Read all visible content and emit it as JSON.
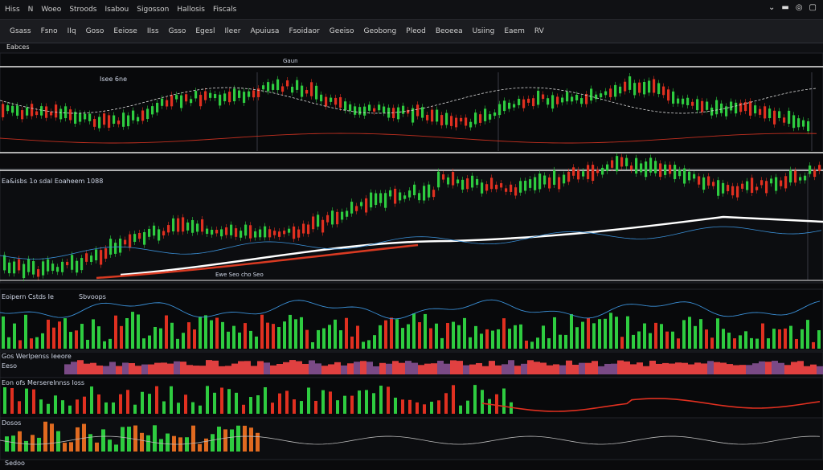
{
  "menu": [
    "Hiss",
    "N",
    "Woeo",
    "Stroods",
    "Isabou",
    "Sigosson",
    "Hallosis",
    "Fiscals"
  ],
  "toolbar": [
    "Gsass",
    "Fsno",
    "IIq",
    "Goso",
    "Eeiose",
    "IIss",
    "Gsso",
    "Egesl",
    "Ileer",
    "Apuiusa",
    "Fsoidaor",
    "Geeiso",
    "Geobong",
    "Pleod",
    "Beoeea",
    "Usiing",
    "Eaem",
    "RV"
  ],
  "subbar_label": "Eabces",
  "panel1": {
    "label": "Isee 6ne",
    "price_tag": "Gaun"
  },
  "panel2": {
    "label": "Ea&isbs 1o sdal Eoaheem 1088",
    "footer": "Ewe Seo cho Seo"
  },
  "panel3": {
    "label": "Eoipern Cstds Ie",
    "sublabel": "Sbvoops"
  },
  "panel4": {
    "label": "Gos Werlpenss Ieeore",
    "sublabel": "Eeso"
  },
  "panel5": {
    "label": "Eon ofs Merserelnnss Ioss",
    "sublabel": "Dosos"
  },
  "footer_label": "Sedoo",
  "colors": {
    "up": "#2ecc40",
    "down": "#e03020",
    "line": "#ffffff",
    "ma": "#ffffff",
    "blue": "#3a8fd6"
  }
}
